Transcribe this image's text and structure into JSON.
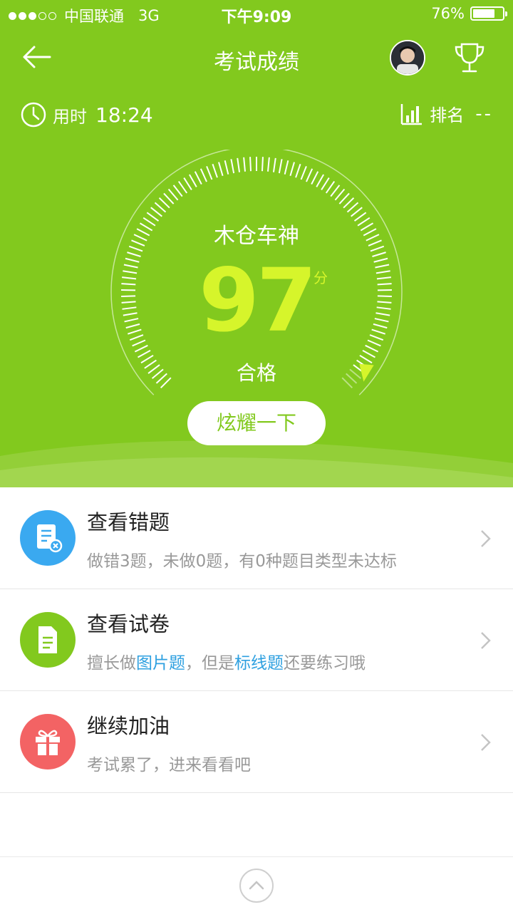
{
  "status_bar": {
    "signal_dots": [
      true,
      true,
      true,
      false,
      false
    ],
    "carrier": "中国联通",
    "network": "3G",
    "time": "下午9:09",
    "battery_text": "76%",
    "battery_level": 0.76
  },
  "navbar": {
    "title": "考试成绩",
    "back_icon": "back-arrow-icon",
    "trophy_icon": "trophy-icon"
  },
  "stats": {
    "time_label": "用时",
    "time_value": "18:24",
    "rank_label": "排名",
    "rank_value": "--"
  },
  "result": {
    "name": "木仓车神",
    "score": "97",
    "unit": "分",
    "status": "合格",
    "score_fraction": 0.97
  },
  "share_button": "炫耀一下",
  "items": [
    {
      "title": "查看错题",
      "desc": "做错3题，未做0题，有0种题目类型未达标",
      "icon": "wrong-questions-icon",
      "color": "#3aa9f0"
    },
    {
      "title": "查看试卷",
      "desc_parts": [
        "擅长做",
        "图片题",
        "，但是",
        "标线题",
        "还要练习哦"
      ],
      "icon": "document-icon",
      "color": "#82c91e"
    },
    {
      "title": "继续加油",
      "desc": "考试累了，进来看看吧",
      "icon": "gift-icon",
      "color": "#f36364"
    }
  ],
  "colors": {
    "hero": "#82c91e",
    "score": "#d6f52b",
    "link": "#2ea0e0"
  }
}
